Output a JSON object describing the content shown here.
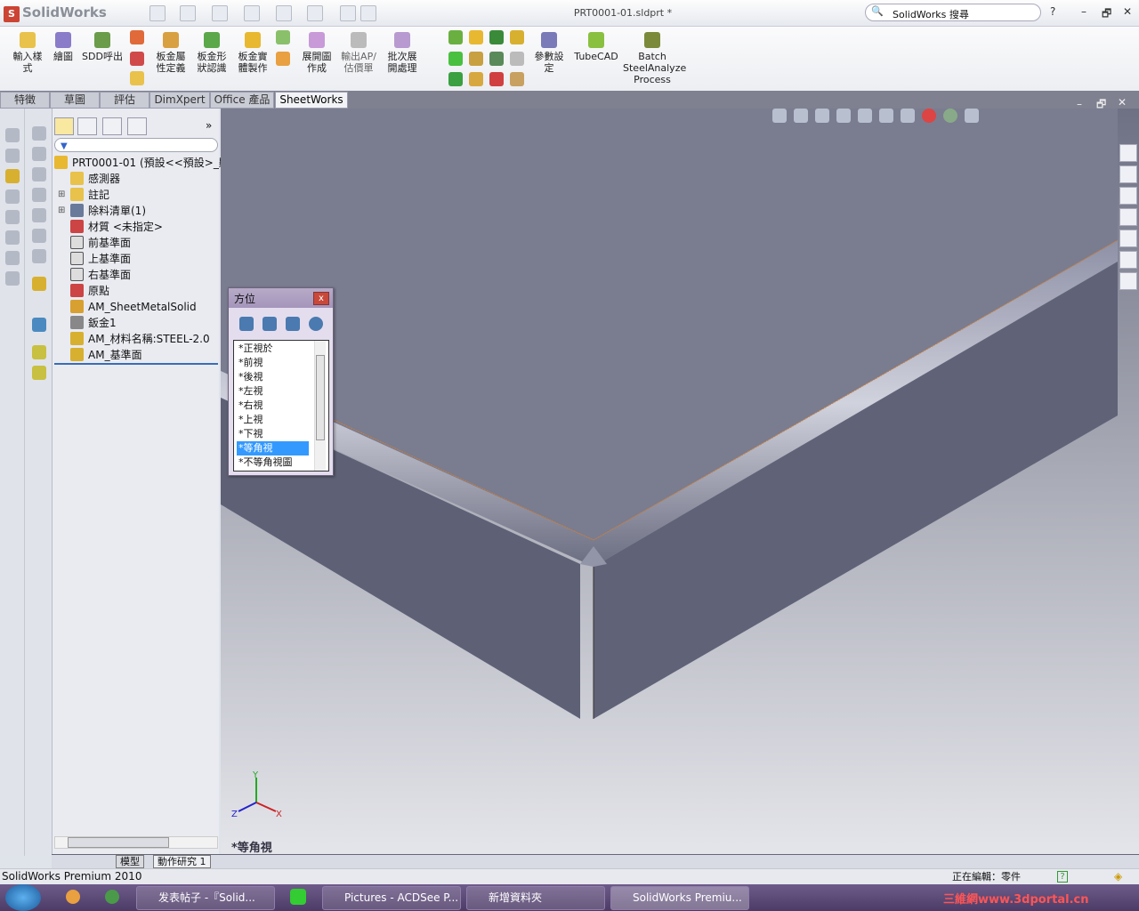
{
  "app": {
    "name": "SolidWorks",
    "doc_title": "PRT0001-01.sldprt *",
    "search_placeholder": "SolidWorks 搜尋"
  },
  "window_controls": {
    "help": "?",
    "minimize": "–",
    "restore": "🗗",
    "close": "✕"
  },
  "ribbon": {
    "buttons": [
      {
        "label": "輸入樣式",
        "icon": "import-style-icon"
      },
      {
        "label": "繪圖",
        "icon": "drawing-icon"
      },
      {
        "label": "SDD呼出",
        "icon": "sdd-call-icon"
      },
      {
        "label": "板金屬性定義",
        "icon": "sheetmetal-property-icon"
      },
      {
        "label": "板金形狀認識",
        "icon": "sheetmetal-shape-icon"
      },
      {
        "label": "板金實體製作",
        "icon": "sheetmetal-solid-icon"
      },
      {
        "label": "展開圖作成",
        "icon": "flat-pattern-icon"
      },
      {
        "label": "輸出AP/估價單",
        "icon": "export-quote-icon"
      },
      {
        "label": "批次展開處理",
        "icon": "batch-unfold-icon"
      },
      {
        "label": "參數設定",
        "icon": "parameter-settings-icon"
      },
      {
        "label": "TubeCAD",
        "icon": "tubecad-icon"
      },
      {
        "label": "Batch SteelAnalyze Process",
        "icon": "batch-steel-icon"
      }
    ]
  },
  "tabs": [
    {
      "label": "特徵"
    },
    {
      "label": "草圖"
    },
    {
      "label": "評估"
    },
    {
      "label": "DimXpert"
    },
    {
      "label": "Office 產品"
    },
    {
      "label": "SheetWorks",
      "active": true
    }
  ],
  "tree": {
    "root": "PRT0001-01  (預設<<預設>_顯",
    "items": [
      {
        "label": "感測器",
        "icon": "sensor-folder-icon"
      },
      {
        "label": "註記",
        "icon": "annotation-icon",
        "expandable": true
      },
      {
        "label": "除料清單(1)",
        "icon": "cut-list-icon",
        "expandable": true
      },
      {
        "label": "材質 <未指定>",
        "icon": "material-icon"
      },
      {
        "label": "前基準面",
        "icon": "plane-icon"
      },
      {
        "label": "上基準面",
        "icon": "plane-icon"
      },
      {
        "label": "右基準面",
        "icon": "plane-icon"
      },
      {
        "label": "原點",
        "icon": "origin-icon"
      },
      {
        "label": "AM_SheetMetalSolid",
        "icon": "feature-icon"
      },
      {
        "label": "鈑金1",
        "icon": "sheetmetal-icon"
      },
      {
        "label": "AM_材料名稱:STEEL-2.0",
        "icon": "attribute-icon"
      },
      {
        "label": "AM_基準面",
        "icon": "attribute-icon"
      }
    ]
  },
  "orientation": {
    "title": "方位",
    "close": "x",
    "items": [
      "*正視於",
      "*前視",
      "*後視",
      "*左視",
      "*右視",
      "*上視",
      "*下視",
      "*等角視",
      "*不等角視圖"
    ],
    "selected": "*等角視"
  },
  "viewport": {
    "view_name": "*等角視",
    "axes": {
      "x": "X",
      "y": "Y",
      "z": "Z"
    },
    "colors": {
      "top": "#7a7c90",
      "side": "#5f6176",
      "edge": "#c87d3a"
    }
  },
  "bottom_tabs": [
    {
      "label": "模型"
    },
    {
      "label": "動作研究 1"
    }
  ],
  "status": {
    "left": "SolidWorks Premium 2010",
    "editing": "正在編輯：零件"
  },
  "taskbar": {
    "tasks": [
      "发表帖子 -『Solid...",
      "Pictures - ACDSee P...",
      "新增資料夾",
      "SolidWorks Premiu..."
    ],
    "watermark": "三維網www.3dportal.cn"
  }
}
